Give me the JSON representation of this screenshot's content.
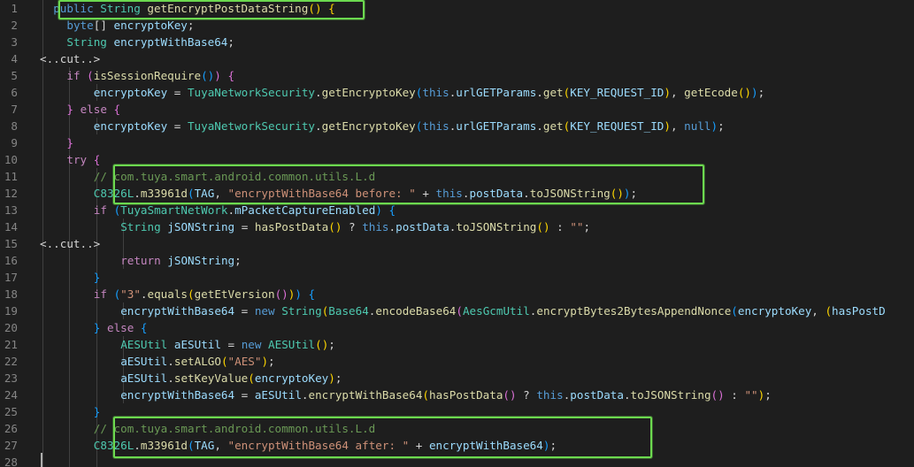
{
  "lines": [
    {
      "n": "1",
      "indent": 2,
      "tokens": [
        [
          "k",
          "public"
        ],
        [
          "p",
          " "
        ],
        [
          "t",
          "String"
        ],
        [
          "p",
          " "
        ],
        [
          "f",
          "getEncryptPostDataString"
        ],
        [
          "b1",
          "()"
        ],
        [
          "p",
          " "
        ],
        [
          "b1",
          "{"
        ]
      ]
    },
    {
      "n": "2",
      "indent": 4,
      "tokens": [
        [
          "k",
          "byte"
        ],
        [
          "p",
          "[] "
        ],
        [
          "v",
          "encryptoKey"
        ],
        [
          "p",
          ";"
        ]
      ]
    },
    {
      "n": "3",
      "indent": 4,
      "tokens": [
        [
          "t",
          "String"
        ],
        [
          "p",
          " "
        ],
        [
          "v",
          "encryptWithBase64"
        ],
        [
          "p",
          ";"
        ]
      ]
    },
    {
      "n": "4",
      "indent": 0,
      "tokens": [
        [
          "cut",
          "<..cut..>"
        ]
      ]
    },
    {
      "n": "5",
      "indent": 4,
      "tokens": [
        [
          "kc",
          "if"
        ],
        [
          "p",
          " "
        ],
        [
          "b2",
          "("
        ],
        [
          "f",
          "isSessionRequire"
        ],
        [
          "b3",
          "()"
        ],
        [
          "b2",
          ")"
        ],
        [
          "p",
          " "
        ],
        [
          "b2",
          "{"
        ]
      ]
    },
    {
      "n": "6",
      "indent": 8,
      "tokens": [
        [
          "v",
          "encryptoKey"
        ],
        [
          "p",
          " = "
        ],
        [
          "t",
          "TuyaNetworkSecurity"
        ],
        [
          "p",
          "."
        ],
        [
          "f",
          "getEncryptoKey"
        ],
        [
          "b3",
          "("
        ],
        [
          "k",
          "this"
        ],
        [
          "p",
          "."
        ],
        [
          "v",
          "urlGETParams"
        ],
        [
          "p",
          "."
        ],
        [
          "f",
          "get"
        ],
        [
          "b1",
          "("
        ],
        [
          "v",
          "KEY_REQUEST_ID"
        ],
        [
          "b1",
          ")"
        ],
        [
          "p",
          ", "
        ],
        [
          "f",
          "getEcode"
        ],
        [
          "b1",
          "()"
        ],
        [
          "b3",
          ")"
        ],
        [
          "p",
          ";"
        ]
      ]
    },
    {
      "n": "7",
      "indent": 4,
      "tokens": [
        [
          "b2",
          "}"
        ],
        [
          "p",
          " "
        ],
        [
          "kc",
          "else"
        ],
        [
          "p",
          " "
        ],
        [
          "b2",
          "{"
        ]
      ]
    },
    {
      "n": "8",
      "indent": 8,
      "tokens": [
        [
          "v",
          "encryptoKey"
        ],
        [
          "p",
          " = "
        ],
        [
          "t",
          "TuyaNetworkSecurity"
        ],
        [
          "p",
          "."
        ],
        [
          "f",
          "getEncryptoKey"
        ],
        [
          "b3",
          "("
        ],
        [
          "k",
          "this"
        ],
        [
          "p",
          "."
        ],
        [
          "v",
          "urlGETParams"
        ],
        [
          "p",
          "."
        ],
        [
          "f",
          "get"
        ],
        [
          "b1",
          "("
        ],
        [
          "v",
          "KEY_REQUEST_ID"
        ],
        [
          "b1",
          ")"
        ],
        [
          "p",
          ", "
        ],
        [
          "k",
          "null"
        ],
        [
          "b3",
          ")"
        ],
        [
          "p",
          ";"
        ]
      ]
    },
    {
      "n": "9",
      "indent": 4,
      "tokens": [
        [
          "b2",
          "}"
        ]
      ]
    },
    {
      "n": "10",
      "indent": 4,
      "tokens": [
        [
          "kc",
          "try"
        ],
        [
          "p",
          " "
        ],
        [
          "b2",
          "{"
        ]
      ]
    },
    {
      "n": "11",
      "indent": 8,
      "tokens": [
        [
          "c",
          "// com.tuya.smart.android.common.utils.L.d"
        ]
      ]
    },
    {
      "n": "12",
      "indent": 8,
      "tokens": [
        [
          "t",
          "C8326L"
        ],
        [
          "p",
          "."
        ],
        [
          "f",
          "m33961d"
        ],
        [
          "b3",
          "("
        ],
        [
          "v",
          "TAG"
        ],
        [
          "p",
          ", "
        ],
        [
          "s",
          "\"encryptWithBase64 before: \""
        ],
        [
          "p",
          " + "
        ],
        [
          "k",
          "this"
        ],
        [
          "p",
          "."
        ],
        [
          "v",
          "postData"
        ],
        [
          "p",
          "."
        ],
        [
          "f",
          "toJSONString"
        ],
        [
          "b1",
          "()"
        ],
        [
          "b3",
          ")"
        ],
        [
          "p",
          ";"
        ]
      ]
    },
    {
      "n": "13",
      "indent": 8,
      "tokens": [
        [
          "kc",
          "if"
        ],
        [
          "p",
          " "
        ],
        [
          "b3",
          "("
        ],
        [
          "t",
          "TuyaSmartNetWork"
        ],
        [
          "p",
          "."
        ],
        [
          "v",
          "mPacketCaptureEnabled"
        ],
        [
          "b3",
          ")"
        ],
        [
          "p",
          " "
        ],
        [
          "b3",
          "{"
        ]
      ]
    },
    {
      "n": "14",
      "indent": 12,
      "tokens": [
        [
          "t",
          "String"
        ],
        [
          "p",
          " "
        ],
        [
          "v",
          "jSONString"
        ],
        [
          "p",
          " = "
        ],
        [
          "f",
          "hasPostData"
        ],
        [
          "b1",
          "()"
        ],
        [
          "p",
          " ? "
        ],
        [
          "k",
          "this"
        ],
        [
          "p",
          "."
        ],
        [
          "v",
          "postData"
        ],
        [
          "p",
          "."
        ],
        [
          "f",
          "toJSONString"
        ],
        [
          "b1",
          "()"
        ],
        [
          "p",
          " : "
        ],
        [
          "s",
          "\"\""
        ],
        [
          "p",
          ";"
        ]
      ]
    },
    {
      "n": "15",
      "indent": 0,
      "tokens": [
        [
          "cut",
          "<..cut..>"
        ]
      ]
    },
    {
      "n": "16",
      "indent": 12,
      "tokens": [
        [
          "kc",
          "return"
        ],
        [
          "p",
          " "
        ],
        [
          "v",
          "jSONString"
        ],
        [
          "p",
          ";"
        ]
      ]
    },
    {
      "n": "17",
      "indent": 8,
      "tokens": [
        [
          "b3",
          "}"
        ]
      ]
    },
    {
      "n": "18",
      "indent": 8,
      "tokens": [
        [
          "kc",
          "if"
        ],
        [
          "p",
          " "
        ],
        [
          "b3",
          "("
        ],
        [
          "s",
          "\"3\""
        ],
        [
          "p",
          "."
        ],
        [
          "f",
          "equals"
        ],
        [
          "b1",
          "("
        ],
        [
          "f",
          "getEtVersion"
        ],
        [
          "b2",
          "()"
        ],
        [
          "b1",
          ")"
        ],
        [
          "b3",
          ")"
        ],
        [
          "p",
          " "
        ],
        [
          "b3",
          "{"
        ]
      ]
    },
    {
      "n": "19",
      "indent": 12,
      "tokens": [
        [
          "v",
          "encryptWithBase64"
        ],
        [
          "p",
          " = "
        ],
        [
          "k",
          "new"
        ],
        [
          "p",
          " "
        ],
        [
          "t",
          "String"
        ],
        [
          "b1",
          "("
        ],
        [
          "t",
          "Base64"
        ],
        [
          "p",
          "."
        ],
        [
          "f",
          "encodeBase64"
        ],
        [
          "b2",
          "("
        ],
        [
          "t",
          "AesGcmUtil"
        ],
        [
          "p",
          "."
        ],
        [
          "f",
          "encryptBytes2BytesAppendNonce"
        ],
        [
          "b3",
          "("
        ],
        [
          "v",
          "encryptoKey"
        ],
        [
          "p",
          ", "
        ],
        [
          "b1",
          "("
        ],
        [
          "v",
          "hasPostD"
        ]
      ]
    },
    {
      "n": "20",
      "indent": 8,
      "tokens": [
        [
          "b3",
          "}"
        ],
        [
          "p",
          " "
        ],
        [
          "kc",
          "else"
        ],
        [
          "p",
          " "
        ],
        [
          "b3",
          "{"
        ]
      ]
    },
    {
      "n": "21",
      "indent": 12,
      "tokens": [
        [
          "t",
          "AESUtil"
        ],
        [
          "p",
          " "
        ],
        [
          "v",
          "aESUtil"
        ],
        [
          "p",
          " = "
        ],
        [
          "k",
          "new"
        ],
        [
          "p",
          " "
        ],
        [
          "t",
          "AESUtil"
        ],
        [
          "b1",
          "()"
        ],
        [
          "p",
          ";"
        ]
      ]
    },
    {
      "n": "22",
      "indent": 12,
      "tokens": [
        [
          "v",
          "aESUtil"
        ],
        [
          "p",
          "."
        ],
        [
          "f",
          "setALGO"
        ],
        [
          "b1",
          "("
        ],
        [
          "s",
          "\"AES\""
        ],
        [
          "b1",
          ")"
        ],
        [
          "p",
          ";"
        ]
      ]
    },
    {
      "n": "23",
      "indent": 12,
      "tokens": [
        [
          "v",
          "aESUtil"
        ],
        [
          "p",
          "."
        ],
        [
          "f",
          "setKeyValue"
        ],
        [
          "b1",
          "("
        ],
        [
          "v",
          "encryptoKey"
        ],
        [
          "b1",
          ")"
        ],
        [
          "p",
          ";"
        ]
      ]
    },
    {
      "n": "24",
      "indent": 12,
      "tokens": [
        [
          "v",
          "encryptWithBase64"
        ],
        [
          "p",
          " = "
        ],
        [
          "v",
          "aESUtil"
        ],
        [
          "p",
          "."
        ],
        [
          "f",
          "encryptWithBase64"
        ],
        [
          "b1",
          "("
        ],
        [
          "f",
          "hasPostData"
        ],
        [
          "b2",
          "()"
        ],
        [
          "p",
          " ? "
        ],
        [
          "k",
          "this"
        ],
        [
          "p",
          "."
        ],
        [
          "v",
          "postData"
        ],
        [
          "p",
          "."
        ],
        [
          "f",
          "toJSONString"
        ],
        [
          "b2",
          "()"
        ],
        [
          "p",
          " : "
        ],
        [
          "s",
          "\"\""
        ],
        [
          "b1",
          ")"
        ],
        [
          "p",
          ";"
        ]
      ]
    },
    {
      "n": "25",
      "indent": 8,
      "tokens": [
        [
          "b3",
          "}"
        ]
      ]
    },
    {
      "n": "26",
      "indent": 8,
      "tokens": [
        [
          "c",
          "// com.tuya.smart.android.common.utils.L.d"
        ]
      ]
    },
    {
      "n": "27",
      "indent": 8,
      "tokens": [
        [
          "t",
          "C8326L"
        ],
        [
          "p",
          "."
        ],
        [
          "f",
          "m33961d"
        ],
        [
          "b3",
          "("
        ],
        [
          "v",
          "TAG"
        ],
        [
          "p",
          ", "
        ],
        [
          "s",
          "\"encryptWithBase64 after: \""
        ],
        [
          "p",
          " + "
        ],
        [
          "v",
          "encryptWithBase64"
        ],
        [
          "b3",
          ")"
        ],
        [
          "p",
          ";"
        ]
      ]
    },
    {
      "n": "28",
      "indent": 0,
      "tokens": []
    }
  ],
  "colors": {
    "background": "#1e1e1e",
    "highlight": "#6cd94f",
    "line_number": "#858585"
  }
}
